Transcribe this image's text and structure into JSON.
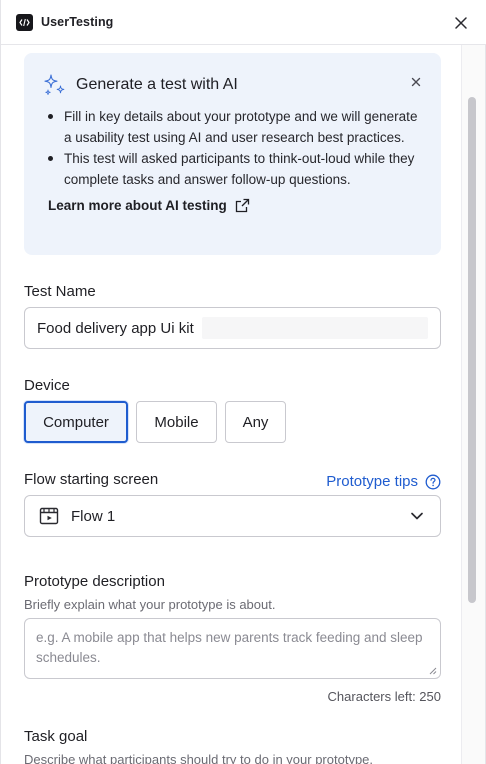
{
  "window": {
    "title": "UserTesting"
  },
  "ai_banner": {
    "title": "Generate a test with AI",
    "bullets": [
      "Fill in key details about your prototype and we will generate a usability test using AI and user research best practices.",
      "This test will asked participants to think-out-loud while they complete tasks and answer follow-up questions."
    ],
    "link": "Learn more about AI testing"
  },
  "test_name": {
    "label": "Test Name",
    "value": "Food delivery app Ui kit"
  },
  "device": {
    "label": "Device",
    "options": [
      "Computer",
      "Mobile",
      "Any"
    ],
    "selected": "Computer"
  },
  "flow": {
    "label": "Flow starting screen",
    "tips_link": "Prototype tips",
    "value": "Flow 1"
  },
  "description": {
    "label": "Prototype description",
    "help": "Briefly explain what your prototype is about.",
    "placeholder": "e.g. A mobile app that helps new parents track feeding and sleep schedules.",
    "chars_left": "Characters left: 250"
  },
  "task_goal": {
    "label": "Task goal",
    "help": "Describe what participants should try to do in your prototype."
  },
  "colors": {
    "accent": "#1f5ccf",
    "banner_bg": "#eef3fb"
  }
}
